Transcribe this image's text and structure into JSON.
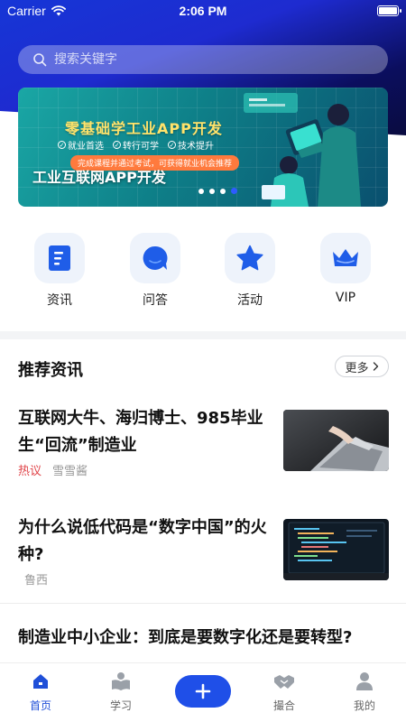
{
  "status_bar": {
    "carrier": "Carrier",
    "time": "2:06 PM"
  },
  "search": {
    "placeholder": "搜索关键字",
    "value": ""
  },
  "banner": {
    "headline": "零基础学工业APP开发",
    "features": [
      "就业首选",
      "转行可学",
      "技术提升"
    ],
    "pill": "完成课程并通过考试，可获得就业机会推荐",
    "caption": "工业互联网APP开发",
    "slide_count": 4,
    "active_slide": 4
  },
  "quick_nav": [
    {
      "label": "资讯",
      "icon": "news-icon"
    },
    {
      "label": "问答",
      "icon": "chat-bubble-icon"
    },
    {
      "label": "活动",
      "icon": "star-icon"
    },
    {
      "label": "VIP",
      "icon": "crown-icon"
    }
  ],
  "recommended": {
    "title": "推荐资讯",
    "more_label": "更多",
    "articles": [
      {
        "title": "互联网大牛、海归博士、985毕业生“回流”制造业",
        "tag": "热议",
        "author": "雪雪酱",
        "thumb": "laptop-photo"
      },
      {
        "title": "为什么说低代码是“数字中国”的火种?",
        "tag": "",
        "author": "鲁西",
        "thumb": "code-screen-photo"
      },
      {
        "title": "制造业中小企业：到底是要数字化还是要转型?",
        "tag": "",
        "author": "",
        "thumb": ""
      }
    ]
  },
  "tabbar": {
    "items": [
      {
        "label": "首页",
        "icon": "home-icon",
        "active": true
      },
      {
        "label": "学习",
        "icon": "book-icon",
        "active": false
      },
      {
        "label": "撮合",
        "icon": "handshake-icon",
        "active": false
      },
      {
        "label": "我的",
        "icon": "user-icon",
        "active": false
      }
    ],
    "center_icon": "plus-icon"
  },
  "colors": {
    "accent": "#1f4fe8",
    "hot_tag": "#e0454a",
    "header_start": "#1636d6",
    "header_end": "#0a0c40"
  }
}
